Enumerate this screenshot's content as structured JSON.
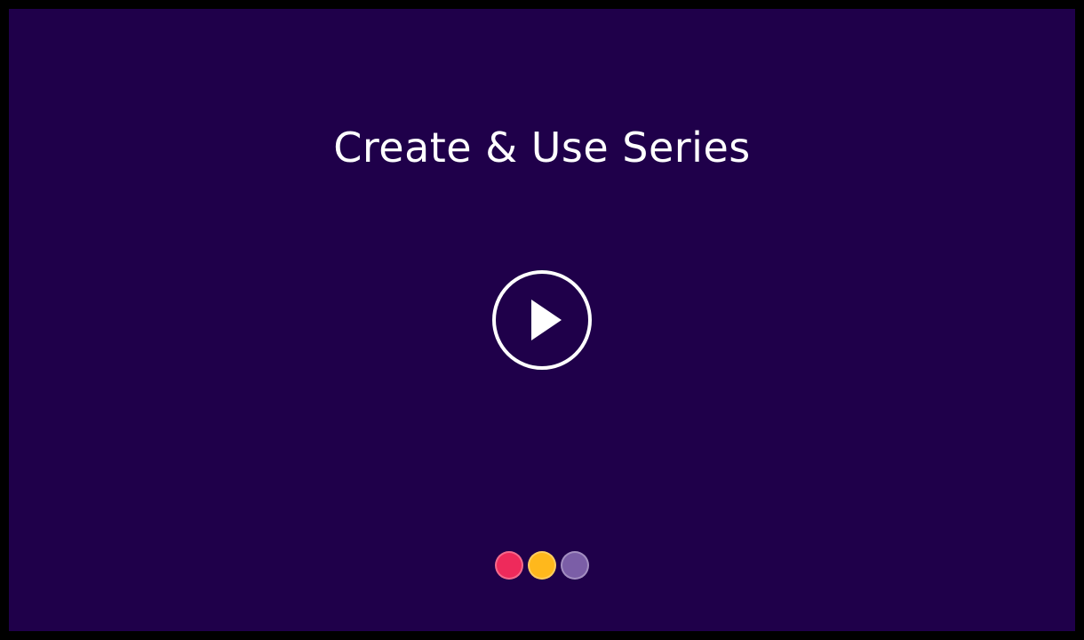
{
  "slide": {
    "title": "Create & Use Series",
    "background_color": "#1f004a",
    "border_color": "#000000"
  },
  "play_button": {
    "icon": "play-icon",
    "color": "#ffffff"
  },
  "brand_dots": [
    {
      "color": "#ee2a5b"
    },
    {
      "color": "#ffb81c"
    },
    {
      "color": "#7b5ea7"
    }
  ]
}
